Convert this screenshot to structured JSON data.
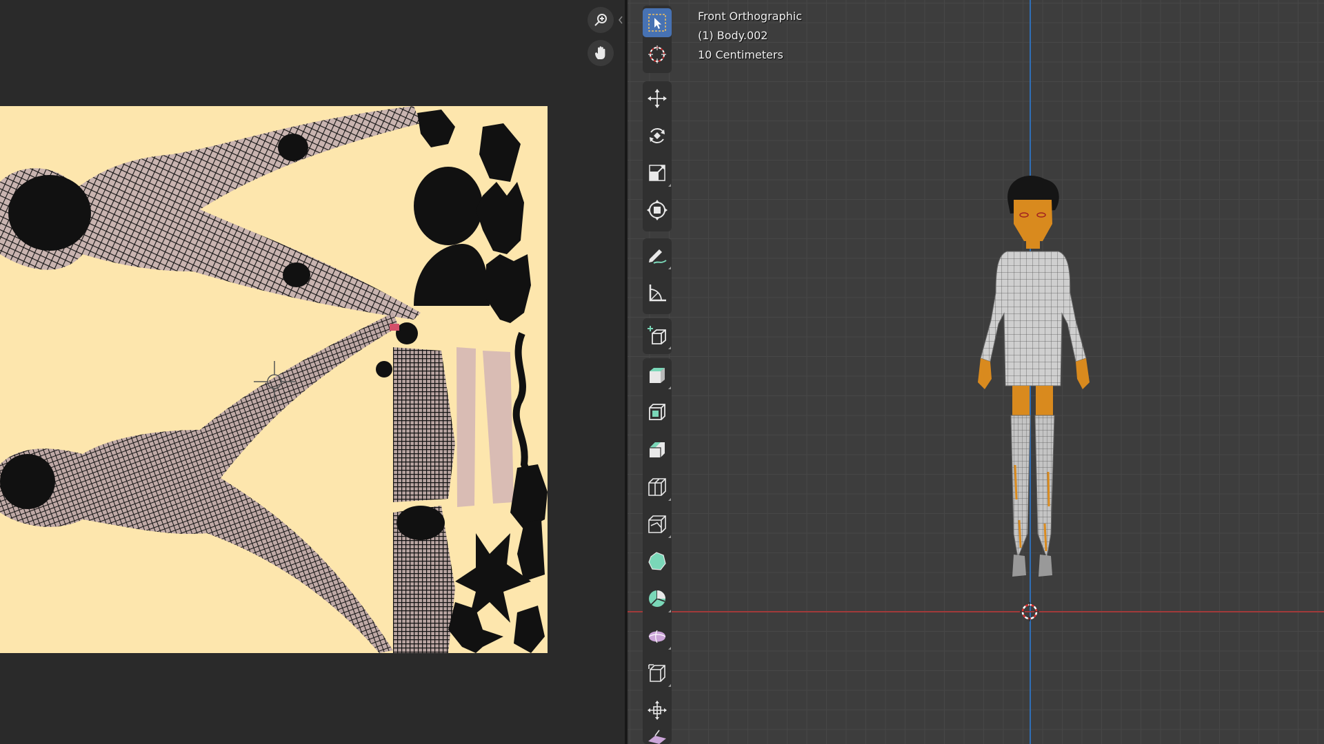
{
  "viewport": {
    "view_name": "Front Orthographic",
    "object_name": "(1) Body.002",
    "grid_scale": "10 Centimeters"
  },
  "uv_editor": {
    "nav_icons": [
      "zoom-icon",
      "hand-pan-icon"
    ]
  },
  "toolbar": {
    "tools": [
      {
        "name": "select-box",
        "icon": "select-box-icon",
        "active": true
      },
      {
        "name": "cursor",
        "icon": "cursor-3d-icon"
      },
      {
        "name": "move",
        "icon": "move-icon"
      },
      {
        "name": "rotate",
        "icon": "rotate-icon"
      },
      {
        "name": "scale",
        "icon": "scale-icon"
      },
      {
        "name": "transform",
        "icon": "transform-icon"
      },
      {
        "name": "annotate",
        "icon": "annotate-icon"
      },
      {
        "name": "measure",
        "icon": "measure-icon"
      },
      {
        "name": "add-cube",
        "icon": "add-cube-icon"
      },
      {
        "name": "extrude-region",
        "icon": "extrude-region-icon"
      },
      {
        "name": "inset-faces",
        "icon": "inset-faces-icon"
      },
      {
        "name": "bevel",
        "icon": "bevel-icon"
      },
      {
        "name": "loop-cut",
        "icon": "loop-cut-icon"
      },
      {
        "name": "knife",
        "icon": "knife-icon"
      },
      {
        "name": "poly-build",
        "icon": "poly-build-icon"
      },
      {
        "name": "spin",
        "icon": "spin-icon"
      },
      {
        "name": "smooth",
        "icon": "smooth-icon"
      },
      {
        "name": "edge-slide",
        "icon": "edge-slide-icon"
      },
      {
        "name": "shrink-fatten",
        "icon": "shrink-fatten-icon"
      },
      {
        "name": "shear",
        "icon": "shear-icon"
      }
    ]
  },
  "colors": {
    "accent": "#4772b3",
    "uv_background": "#fde6ad",
    "z_axis": "#2f6fb7",
    "x_axis": "#a23a3a"
  }
}
